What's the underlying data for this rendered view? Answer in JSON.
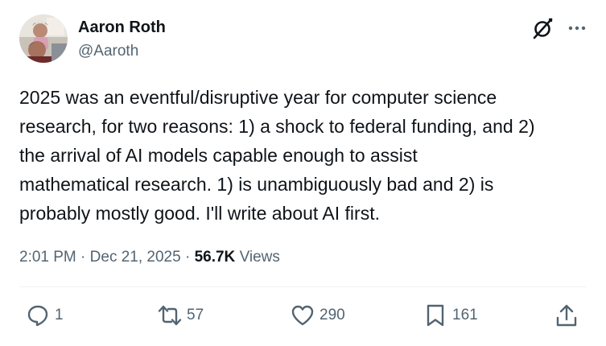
{
  "author": {
    "name": "Aaron Roth",
    "handle": "@Aaroth"
  },
  "post": {
    "text": "2025 was an eventful/disruptive year for computer science\nresearch, for two reasons: 1) a shock to federal funding, and 2)\nthe arrival of AI models capable enough to assist\nmathematical research. 1) is unambiguously bad and 2) is\nprobably mostly good. I'll write about AI first.",
    "time": "2:01 PM",
    "separator": "·",
    "date": "Dec 21, 2025",
    "views_count": "56.7K",
    "views_label": "Views"
  },
  "actions": {
    "replies": "1",
    "reposts": "57",
    "likes": "290",
    "bookmarks": "161"
  },
  "icons": {
    "grok": "grok-icon",
    "more": "more-icon",
    "reply": "reply-icon",
    "repost": "repost-icon",
    "like": "heart-icon",
    "bookmark": "bookmark-icon",
    "share": "share-icon"
  },
  "colors": {
    "text": "#0f1419",
    "secondary": "#536471",
    "divider": "#eff3f4"
  }
}
